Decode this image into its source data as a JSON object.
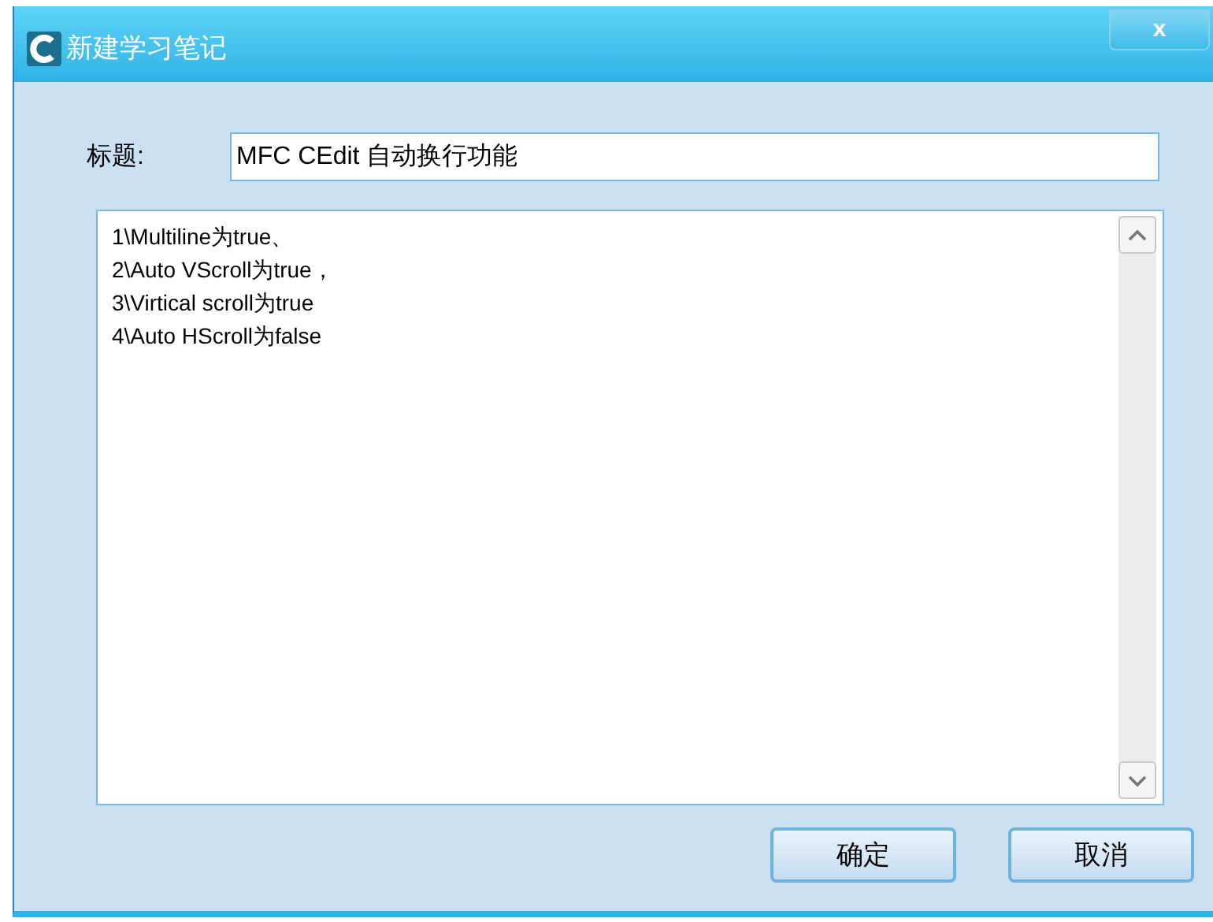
{
  "window": {
    "title": "新建学习笔记",
    "close_label": "x"
  },
  "title_field": {
    "label": "标题:",
    "value": "MFC CEdit 自动换行功能"
  },
  "content_lines": [
    "1\\Multiline为true、",
    "2\\Auto VScroll为true，",
    "3\\Virtical scroll为true",
    "4\\Auto HScroll为false"
  ],
  "buttons": [
    "确定",
    "取消"
  ]
}
